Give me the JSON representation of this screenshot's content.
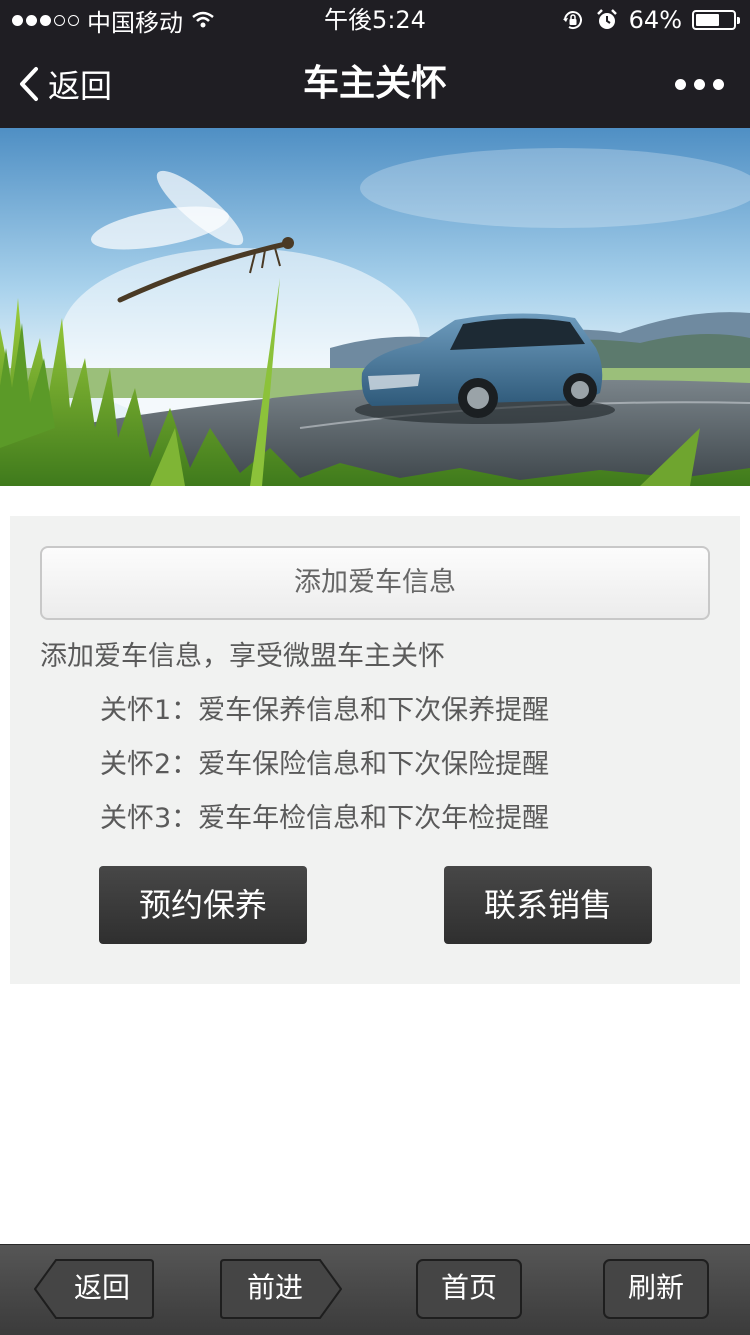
{
  "status_bar": {
    "carrier": "中国移动",
    "time": "午後5:24",
    "battery_text": "64%",
    "battery_level": 0.64
  },
  "nav": {
    "back_label": "返回",
    "title": "车主关怀"
  },
  "card": {
    "add_button": "添加爱车信息",
    "intro": "添加爱车信息，享受微盟车主关怀",
    "care_items": [
      "关怀1：爱车保养信息和下次保养提醒",
      "关怀2：爱车保险信息和下次保险提醒",
      "关怀3：爱车年检信息和下次年检提醒"
    ],
    "buttons": {
      "maintenance": "预约保养",
      "contact_sales": "联系销售"
    }
  },
  "toolbar": {
    "back": "返回",
    "forward": "前进",
    "home": "首页",
    "refresh": "刷新"
  }
}
